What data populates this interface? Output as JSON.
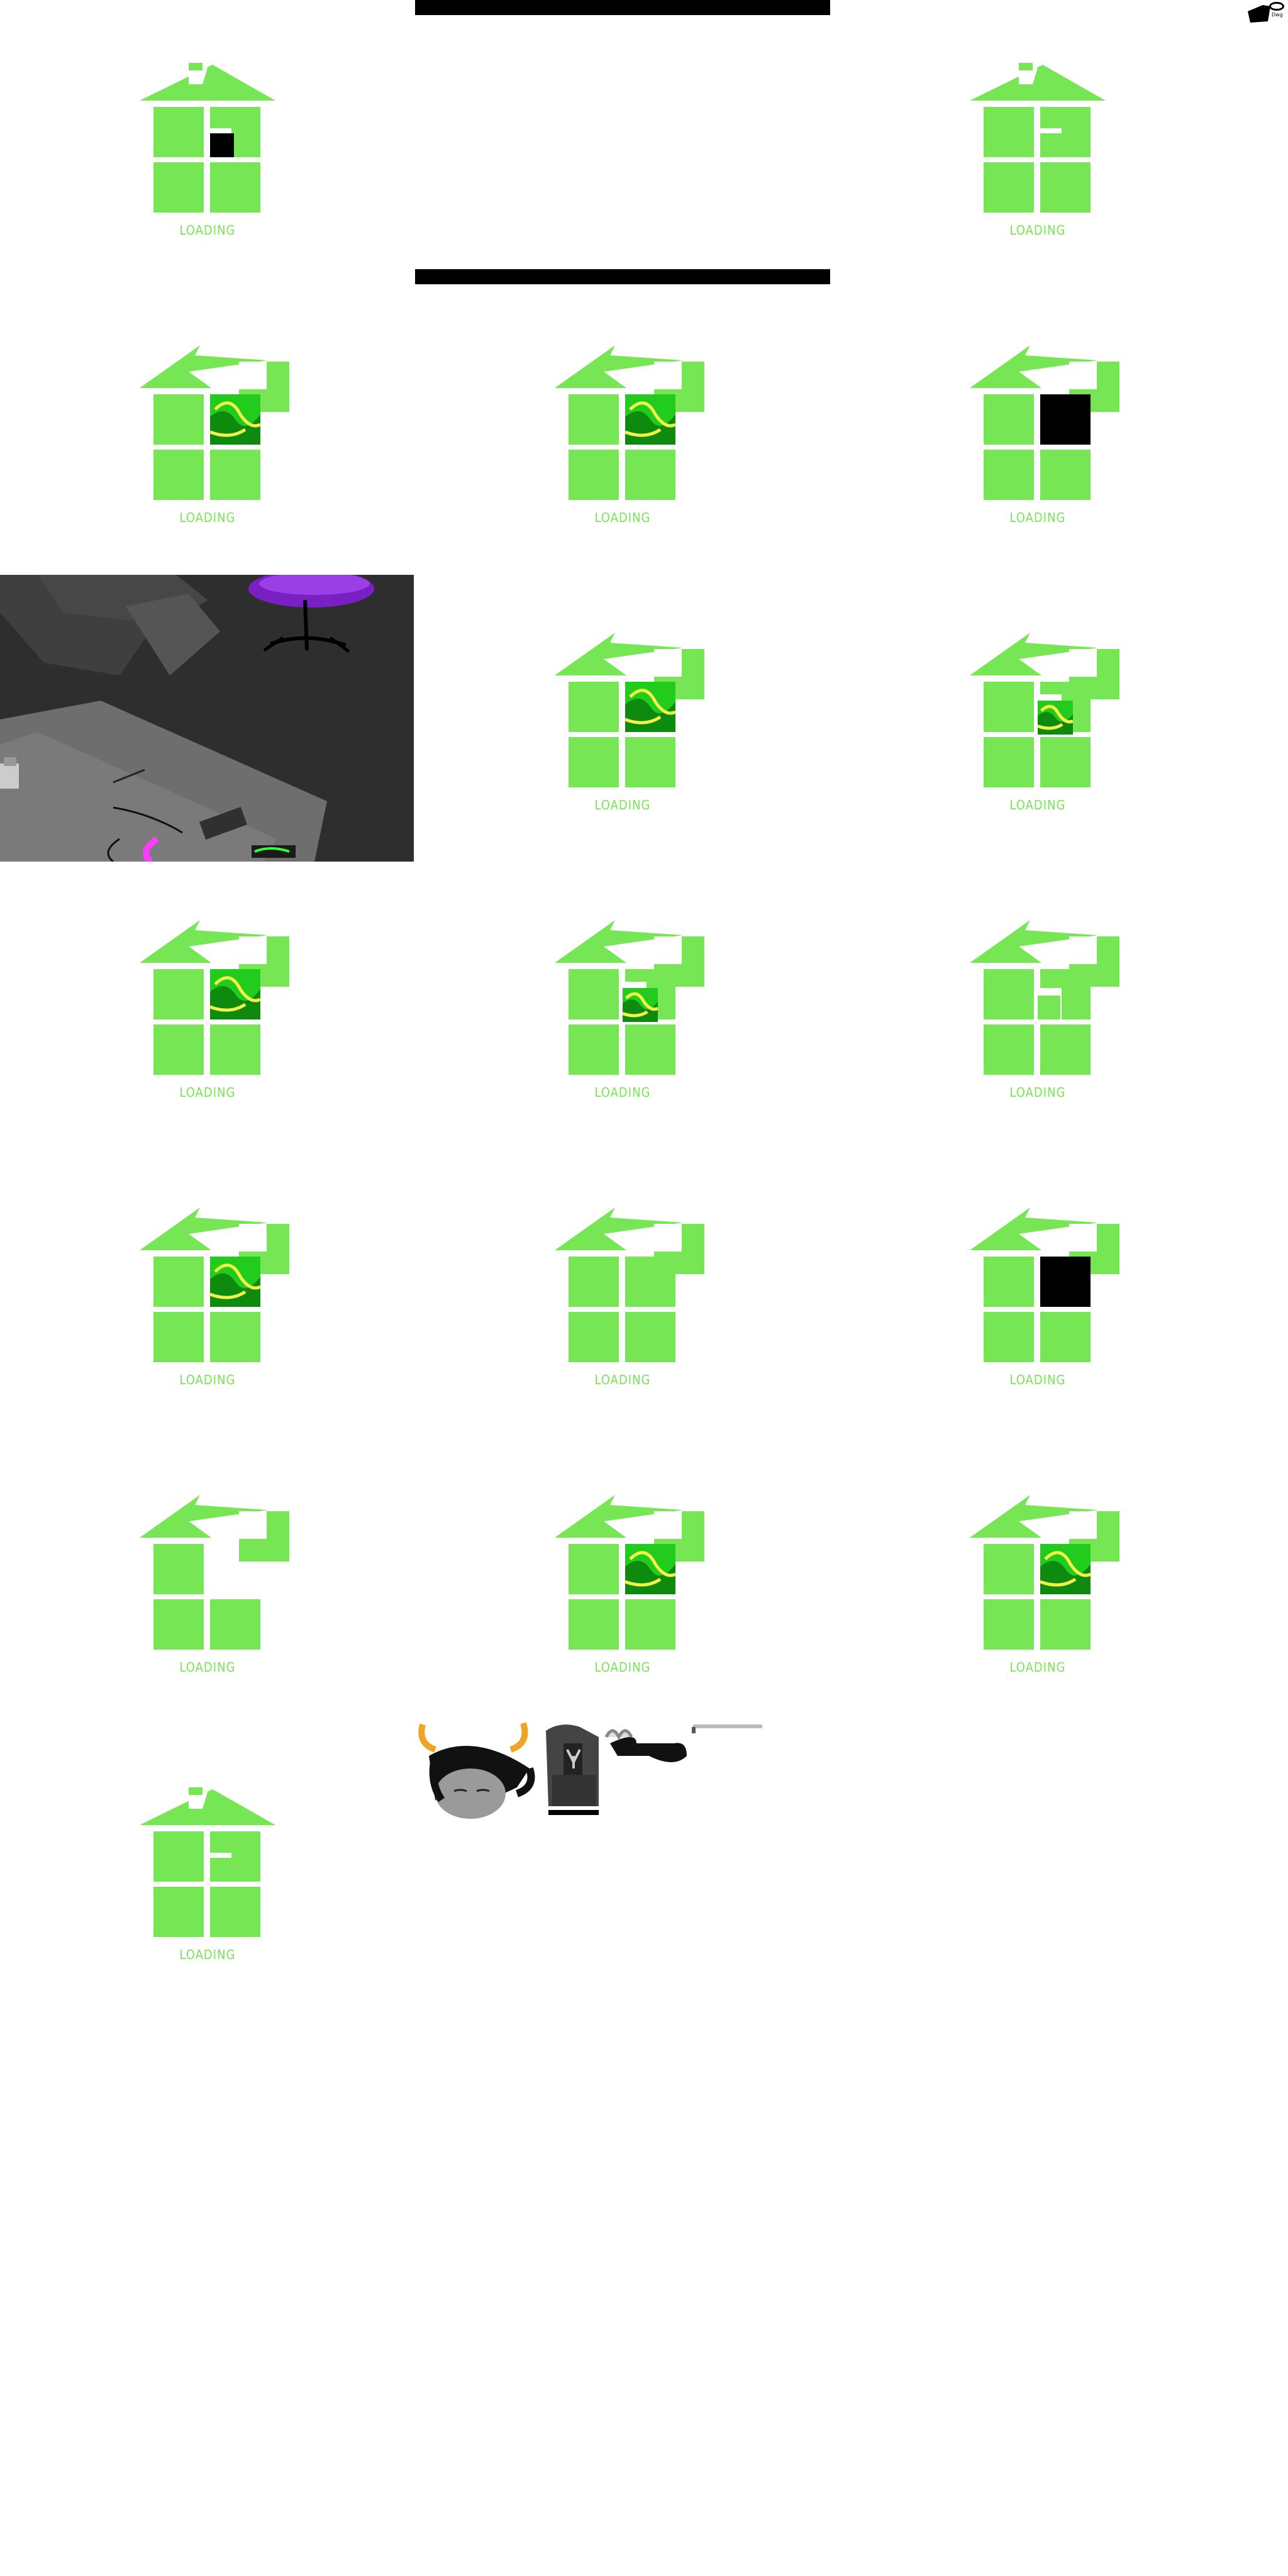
{
  "loading_label": "LOADING",
  "colors": {
    "house": "#76e655",
    "black": "#000000",
    "screen_green": "#22cc1c",
    "screen_dark": "#0e8a0e",
    "screen_yellow": "#f2f24a"
  },
  "tiles": [
    {
      "variant": "plain",
      "window": "black"
    },
    {
      "variant": "plain",
      "window": "none"
    },
    {
      "variant": "wind",
      "window": "green-large"
    },
    {
      "variant": "wind",
      "window": "green-large"
    },
    {
      "variant": "wind",
      "window": "black-large"
    },
    {
      "variant": "wind",
      "window": "green-large"
    },
    {
      "variant": "wind",
      "window": "green-small"
    },
    {
      "variant": "wind",
      "window": "green-large"
    },
    {
      "variant": "wind",
      "window": "green-small"
    },
    {
      "variant": "wind",
      "window": "empty"
    },
    {
      "variant": "wind",
      "window": "green-large"
    },
    {
      "variant": "wind",
      "window": "none-gap"
    },
    {
      "variant": "wind",
      "window": "black-large"
    },
    {
      "variant": "wind",
      "window": "missing"
    },
    {
      "variant": "wind",
      "window": "green-large"
    },
    {
      "variant": "wind",
      "window": "green-large"
    },
    {
      "variant": "plain",
      "window": "none"
    }
  ],
  "icons": {
    "top_right_logo": "hat-logo-icon",
    "room_scene": "room-scene-image",
    "troll_head": "troll-head-icon",
    "troll_suit": "troll-suit-icon",
    "arm": "arm-icon",
    "needle": "needle-icon"
  }
}
